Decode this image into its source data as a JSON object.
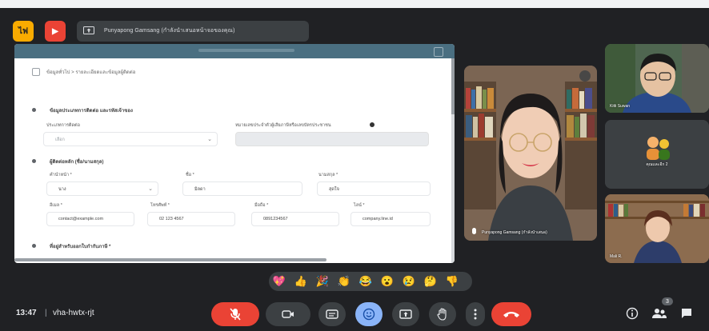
{
  "topbar": {
    "badges": [
      "ไฟ",
      "▶"
    ],
    "share_text": "Punyapong Gamsang (กำลังนำเสนอหน้าจอของคุณ)"
  },
  "shared": {
    "breadcrumb": "ข้อมูลทั่วไป > รายละเอียดและข้อมูลผู้ติดต่อ",
    "section1_title": "ข้อมูลประเภทการติดต่อ และรหัสเจ้าของ",
    "label_a": "ประเภทการติดต่อ",
    "label_b": "หมายเลขประจำตัวผู้เสียภาษีหรือเลขบัตรประชาชน",
    "field_a_placeholder": "เลือก",
    "section2_title": "ผู้ติดต่อหลัก (ชื่อ/นามสกุล)",
    "label_prefix": "คำนำหน้า *",
    "label_first": "ชื่อ *",
    "label_last": "นามสกุล *",
    "val_prefix": "นาง",
    "val_first": "มิลดา",
    "val_last": "สุดใจ",
    "label_email": "อีเมล *",
    "label_phone": "โทรศัพท์ *",
    "label_mobile": "มือถือ *",
    "label_line": "ไลน์ *",
    "val_email": "contact@example.com",
    "val_phone": "02 123 4567",
    "val_mobile": "0891234567",
    "val_line": "company.line.id",
    "section3_title": "ที่อยู่สำหรับออกใบกำกับภาษี *"
  },
  "participants": {
    "main_name": "Punyapong Gamsang (กำลังนำเสนอ)",
    "r1_name": "Kitti Suwan",
    "r2_name": "คุณและอีก 2",
    "r3_name": "Mali R."
  },
  "reactions": [
    "💖",
    "👍",
    "🎉",
    "👏",
    "😂",
    "😮",
    "😢",
    "🤔",
    "👎"
  ],
  "bottombar": {
    "time": "13:47",
    "separator": "|",
    "meeting_code": "vha-hwtx-rjt",
    "participant_count": "3"
  },
  "icons": {
    "mic": "mic-off-icon",
    "camera": "camera-icon",
    "captions": "captions-icon",
    "emoji": "emoji-icon",
    "present": "present-icon",
    "hand": "raise-hand-icon",
    "more": "more-options-icon",
    "end": "end-call-icon",
    "info": "info-icon",
    "people": "people-icon",
    "chat": "chat-icon"
  },
  "colors": {
    "background": "#202124",
    "control": "#3c4043",
    "danger": "#ea4335",
    "accent": "#8ab4f8",
    "badge_yellow": "#f9ab00"
  }
}
